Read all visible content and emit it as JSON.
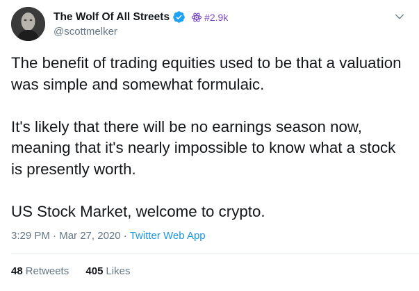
{
  "author": {
    "display_name": "The Wolf Of All Streets",
    "handle": "@scottmelker",
    "badge_icon": "verified-badge-icon",
    "gadget_label": "#2.9k",
    "gadget_icon": "gadget-icon"
  },
  "tweet": {
    "paragraphs": [
      "The benefit of trading equities used to be that a valuation was simple and somewhat formulaic.",
      "It's likely that there will be no earnings season now, meaning that it's nearly impossible to know what a stock is presently worth.",
      "US Stock Market, welcome to crypto."
    ],
    "time": "3:29 PM",
    "separator": "·",
    "date": "Mar 27, 2020",
    "source": "Twitter Web App"
  },
  "stats": {
    "retweets_count": "48",
    "retweets_label": "Retweets",
    "likes_count": "405",
    "likes_label": "Likes"
  },
  "colors": {
    "text": "#14171a",
    "secondary": "#657786",
    "link": "#1b95e0",
    "verified": "#1da1f2",
    "gadget": "#794bc4",
    "divider": "#e6ecf0"
  }
}
